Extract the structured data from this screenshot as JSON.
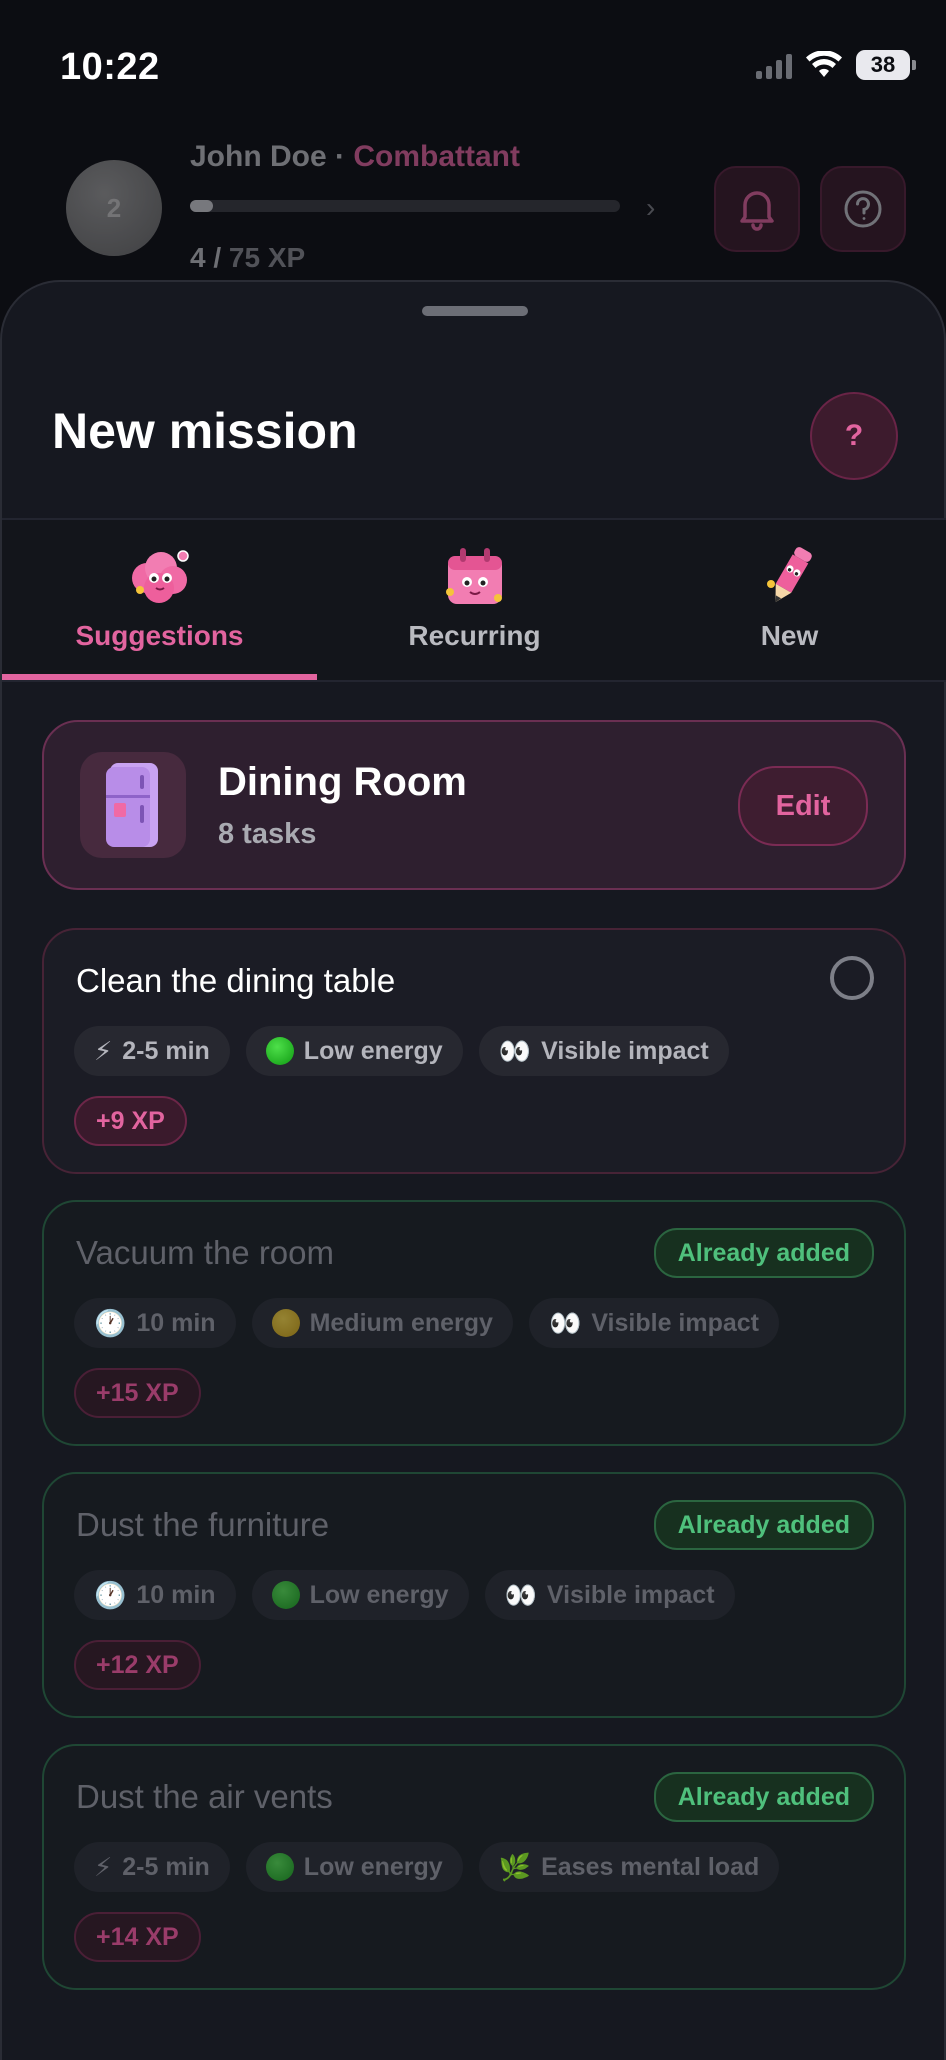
{
  "status_bar": {
    "time": "10:22",
    "battery": "38"
  },
  "header": {
    "avatar_level": "2",
    "user_name": "John Doe",
    "separator": " · ",
    "rank": "Combattant",
    "xp_current": "4 / ",
    "xp_max": "75 XP",
    "xp_progress_fraction": 0.053,
    "icons": {
      "notifications": "bell-icon",
      "help": "question-circle-icon"
    }
  },
  "sheet": {
    "title": "New mission",
    "help_label": "?"
  },
  "tabs": [
    {
      "label": "Suggestions",
      "icon": "brain-mascot-icon",
      "active": true
    },
    {
      "label": "Recurring",
      "icon": "calendar-mascot-icon",
      "active": false
    },
    {
      "label": "New",
      "icon": "pencil-mascot-icon",
      "active": false
    }
  ],
  "room": {
    "name": "Dining Room",
    "count": "8 tasks",
    "edit_label": "Edit",
    "icon": "fridge-icon"
  },
  "tasks": [
    {
      "title": "Clean the dining table",
      "state": "open",
      "duration": "2-5 min",
      "duration_icon": "⚡",
      "energy": "Low energy",
      "energy_color": "#1fbf22",
      "impact": "Visible impact",
      "impact_icon": "👀",
      "xp": "+9 XP"
    },
    {
      "title": "Vacuum the room",
      "state": "added",
      "badge": "Already added",
      "duration": "10 min",
      "duration_icon": "🕐",
      "energy": "Medium energy",
      "energy_color": "#e2b616",
      "impact": "Visible impact",
      "impact_icon": "👀",
      "xp": "+15 XP"
    },
    {
      "title": "Dust the furniture",
      "state": "added",
      "badge": "Already added",
      "duration": "10 min",
      "duration_icon": "🕐",
      "energy": "Low energy",
      "energy_color": "#1fbf22",
      "impact": "Visible impact",
      "impact_icon": "👀",
      "xp": "+12 XP"
    },
    {
      "title": "Dust the air vents",
      "state": "added",
      "badge": "Already added",
      "duration": "2-5 min",
      "duration_icon": "⚡",
      "energy": "Low energy",
      "energy_color": "#1fbf22",
      "impact": "Eases mental load",
      "impact_icon": "🌿",
      "xp": "+14 XP"
    }
  ],
  "colors": {
    "accent": "#e2649f",
    "added_green": "#4fc07c",
    "background": "#161820"
  }
}
